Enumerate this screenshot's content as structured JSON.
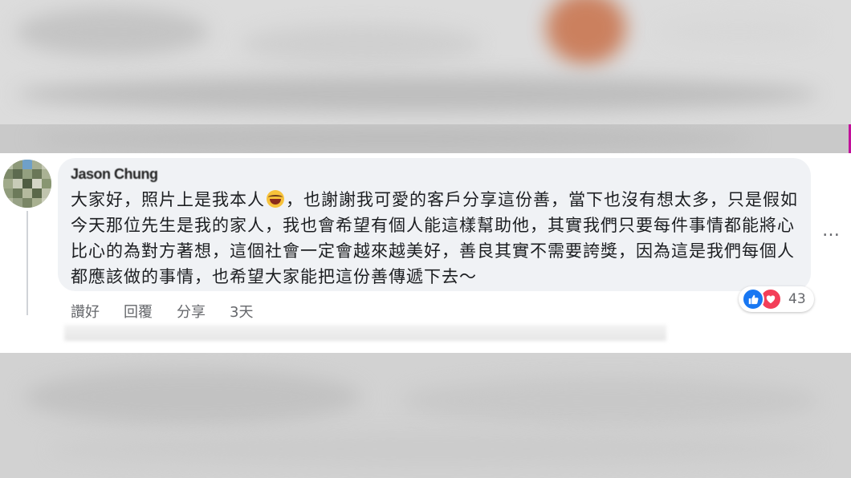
{
  "comment": {
    "author": "Jason Chung",
    "text_line_1a": "大家好，照片上是我本人",
    "text_line_1b": "，也謝謝我可愛的客戶分享這份善，當下也沒有想太多，只",
    "text_rest": "是假如今天那位先生是我的家人，我也會希望有個人能這樣幫助他，其實我們只要每件事情都能將心比心的為對方著想，這個社會一定會越來越美好，善良其實不需要誇獎，因為這是我們每個人都應該做的事情，也希望大家能把這份善傳遞下去～",
    "emoji": "laughing-face-icon"
  },
  "actions": {
    "like": "讚好",
    "reply": "回覆",
    "share": "分享",
    "time": "3天"
  },
  "reactions": {
    "icons": [
      "like-icon",
      "love-icon"
    ],
    "count": "43"
  },
  "more_menu": "…",
  "colors": {
    "bubble": "#f0f2f5",
    "like": "#1877f2",
    "love": "#f33e58",
    "meta_text": "#65676b",
    "edge_accent": "#c2109b"
  }
}
